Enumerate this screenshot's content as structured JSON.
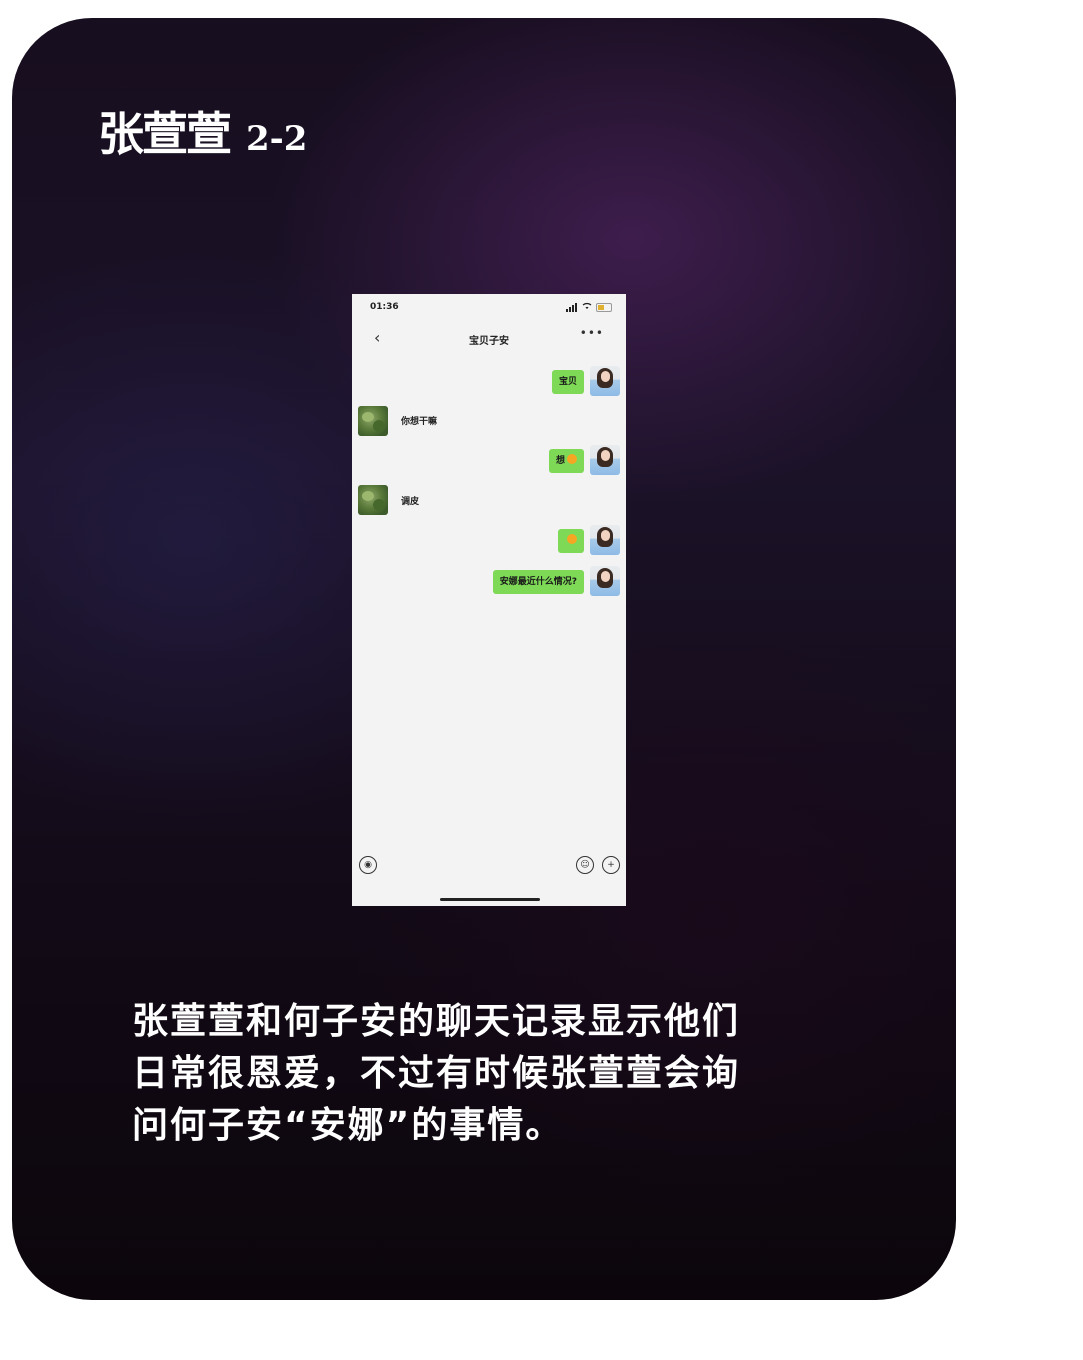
{
  "header": {
    "name": "张萱萱",
    "code": "2-2"
  },
  "phone": {
    "status_time": "01:36",
    "chat_title": "宝贝子安",
    "back_icon": "chevron-left-icon",
    "more_icon": "ellipsis-icon",
    "messages": [
      {
        "side": "out",
        "text": "宝贝"
      },
      {
        "side": "in",
        "text": "你想干嘛"
      },
      {
        "side": "out",
        "text": "想"
      },
      {
        "side": "in",
        "text": "调皮"
      },
      {
        "side": "out",
        "text": ""
      },
      {
        "side": "out",
        "text": "安娜最近什么情况?"
      }
    ],
    "input_bar": {
      "voice_icon": "voice-icon",
      "emoji_icon": "emoji-icon",
      "plus_icon": "plus-icon"
    }
  },
  "caption": {
    "line1": "张萱萱和何子安的聊天记录显示他们",
    "line2": "日常很恩爱，不过有时候张萱萱会询",
    "line3": "问何子安“安娜”的事情。"
  },
  "colors": {
    "bubble_out": "#7ed957",
    "chat_bg": "#f3f3f3",
    "card_bg": "#150c18"
  }
}
